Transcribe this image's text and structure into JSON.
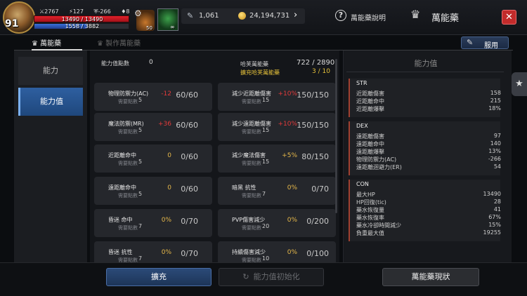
{
  "player": {
    "level": "91",
    "stat1": "2767",
    "stat2": "127",
    "stat3": "-266",
    "stat4": "8",
    "hp": "13490 / 13490",
    "mp": "1558 / 3882",
    "mp_fraction": 0.4
  },
  "items": {
    "potion_count": "50",
    "leaf_count": "∞"
  },
  "currency": {
    "feather": "1,061",
    "gold": "24,194,731"
  },
  "header": {
    "help_label": "萬能藥說明",
    "title": "萬能藥",
    "close_label": "✕"
  },
  "tabs": {
    "potion": "萬能藥",
    "craft": "製作萬能藥"
  },
  "use_button": "服用",
  "nav": {
    "points": "能力",
    "stat": "能力值"
  },
  "summary": {
    "points_label": "能力值點數",
    "points_value": "0",
    "sea_label": "哈芙萬能藥",
    "sea_value": "722 / 2890",
    "sea_exp_label": "擴充哈芙萬能藥",
    "sea_exp_value": "3 / 10"
  },
  "req_label": "需要點數",
  "cards": [
    {
      "name": "物理防禦力(AC)",
      "bonus": "-12",
      "bonus_color": "#e23a3a",
      "progress": "60/60",
      "req": "5"
    },
    {
      "name": "減少近距離傷害",
      "bonus": "+10%",
      "bonus_color": "#e23a3a",
      "progress": "150/150",
      "req": "15"
    },
    {
      "name": "魔法防禦(MR)",
      "bonus": "+36",
      "bonus_color": "#e23a3a",
      "progress": "60/60",
      "req": "5"
    },
    {
      "name": "減少遠距離傷害",
      "bonus": "+10%",
      "bonus_color": "#e23a3a",
      "progress": "150/150",
      "req": "15"
    },
    {
      "name": "近距離命中",
      "bonus": "0",
      "bonus_color": "#e6b84a",
      "progress": "0/60",
      "req": "5"
    },
    {
      "name": "減少魔法傷害",
      "bonus": "+5%",
      "bonus_color": "#e6b84a",
      "progress": "80/150",
      "req": "15"
    },
    {
      "name": "遠距離命中",
      "bonus": "0",
      "bonus_color": "#e6b84a",
      "progress": "0/60",
      "req": "5"
    },
    {
      "name": "暗黑 抗性",
      "bonus": "0%",
      "bonus_color": "#e6b84a",
      "progress": "0/70",
      "req": "7"
    },
    {
      "name": "昏迷 命中",
      "bonus": "0%",
      "bonus_color": "#e6b84a",
      "progress": "0/70",
      "req": "7"
    },
    {
      "name": "PVP傷害減少",
      "bonus": "0%",
      "bonus_color": "#e6b84a",
      "progress": "0/200",
      "req": "20"
    },
    {
      "name": "昏迷 抗性",
      "bonus": "0%",
      "bonus_color": "#e6b84a",
      "progress": "0/70",
      "req": "7"
    },
    {
      "name": "持續傷害減少",
      "bonus": "0%",
      "bonus_color": "#e6b84a",
      "progress": "0/100",
      "req": "10"
    }
  ],
  "stats_panel": {
    "title": "能力值",
    "sections": [
      {
        "name": "STR",
        "rows": [
          {
            "label": "近距離傷害",
            "value": "158"
          },
          {
            "label": "近距離命中",
            "value": "215"
          },
          {
            "label": "近距離爆擊",
            "value": "18%"
          }
        ]
      },
      {
        "name": "DEX",
        "rows": [
          {
            "label": "遠距離傷害",
            "value": "97"
          },
          {
            "label": "遠距離命中",
            "value": "140"
          },
          {
            "label": "遠距離爆擊",
            "value": "13%"
          },
          {
            "label": "物理防禦力(AC)",
            "value": "-266"
          },
          {
            "label": "遠距離迴避力(ER)",
            "value": "54"
          }
        ]
      },
      {
        "name": "CON",
        "rows": [
          {
            "label": "最大HP",
            "value": "13490"
          },
          {
            "label": "HP回復(tic)",
            "value": "28"
          },
          {
            "label": "藥水恢復量",
            "value": "41"
          },
          {
            "label": "藥水恢復率",
            "value": "67%"
          },
          {
            "label": "藥水冷卻時間減少",
            "value": "15%"
          },
          {
            "label": "負重最大值",
            "value": "19255"
          }
        ]
      }
    ]
  },
  "bottom": {
    "expand": "擴充",
    "reset": "能力值初始化",
    "status": "萬能藥現狀"
  }
}
